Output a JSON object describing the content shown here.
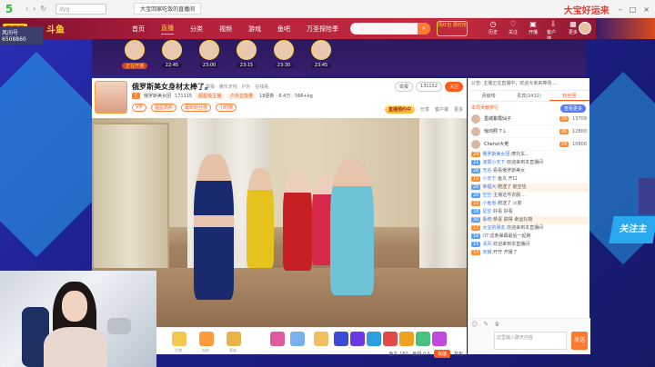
{
  "browser": {
    "logo": "5",
    "address": "dyg",
    "tab_title": "大宝回家吃饭的直播间",
    "brand": "大宝好运来"
  },
  "header": {
    "tag": "风间号",
    "uid": "6508860",
    "logo_text": "斗鱼",
    "nav": [
      "首页",
      "直播",
      "分类",
      "视频",
      "游戏",
      "鱼吧",
      "万圣探险季"
    ],
    "search_placeholder": "",
    "pill": "领红包 限时抢",
    "icons": [
      "历史",
      "关注",
      "开播",
      "客户端",
      "更多"
    ]
  },
  "anchors": [
    {
      "time": "正在开播",
      "hot": true
    },
    {
      "time": "22:45",
      "hot": false
    },
    {
      "time": "23:00",
      "hot": false
    },
    {
      "time": "23:15",
      "hot": false
    },
    {
      "time": "23:30",
      "hot": false
    },
    {
      "time": "23:45",
      "hot": false
    }
  ],
  "room": {
    "title": "俄罗斯美女身材太棒了。",
    "small": "举报 · 娱乐天地 · 户外 · 在线看",
    "name": "俄罗斯美女团",
    "room_no": "171115",
    "badge1": "超星级主播",
    "badge2": "户外正能量",
    "chip1": "VIP",
    "chip2": "福星高照",
    "chip3": "最新粉丝榜",
    "chip4": "小时榜",
    "stats": "18更新 · 8.4万 · 566+kg",
    "btn_report": "举报",
    "btn_count": "131152",
    "btn_follow": "关注",
    "coin": "直播预约中",
    "share": "分享",
    "client": "客户端",
    "more": "更多"
  },
  "toolbar": {
    "labels": [
      "礼物",
      "钻粉",
      "贵族",
      "",
      "",
      "",
      "",
      "",
      "",
      "",
      "",
      ""
    ],
    "right": "鱼丸 160 · 鱼翅 0.6",
    "charge": "充值",
    "backpack": "背包"
  },
  "chat": {
    "notice": "公告: 主播正在直播中，欢迎大家来捧场...",
    "tabs": [
      "贡献榜",
      "贵宾(2432)",
      "粉丝团"
    ],
    "rank_head": "本周贡献排行",
    "rank_btn": "查看更多",
    "ranks": [
      {
        "name": "墨城紫霞仙子",
        "lv": "29",
        "score": "13709"
      },
      {
        "name": "惊鸿照 7 L",
        "lv": "26",
        "score": "12800"
      },
      {
        "name": "Chenxi大佬",
        "lv": "24",
        "score": "10800"
      }
    ],
    "lines": [
      {
        "lv": "23",
        "user": "俄罗斯美女团:",
        "text": "摩托车...",
        "hl": false
      },
      {
        "lv": "21",
        "user": "凌霄小天下:",
        "text": "欢迎来到本直播间",
        "hl": false
      },
      {
        "lv": "26",
        "user": "无名:",
        "text": "看看俄罗斯美女",
        "hl": false
      },
      {
        "lv": "19",
        "user": "小天下:",
        "text": "鱼丸 开口",
        "hl": false
      },
      {
        "lv": "25",
        "user": "幸福大:",
        "text": "赠送了 航空信",
        "hl": true
      },
      {
        "lv": "20",
        "user": "空空:",
        "text": "主播这件衣服...",
        "hl": false
      },
      {
        "lv": "22",
        "user": "小鱼崽:",
        "text": "赠送了 火箭",
        "hl": false
      },
      {
        "lv": "18",
        "user": "星空:",
        "text": "好看 好看",
        "hl": false
      },
      {
        "lv": "30",
        "user": "系统:",
        "text": "恭喜 获得 幸运礼物",
        "hl": true
      },
      {
        "lv": "17",
        "user": "大宝的朋友:",
        "text": "欢迎来到本直播间",
        "hl": false
      },
      {
        "lv": "16",
        "user": "OT:",
        "text": "这条弹幕最后一起跑",
        "hl": false
      },
      {
        "lv": "15",
        "user": "清风:",
        "text": "欢迎来到本直播间",
        "hl": false
      },
      {
        "lv": "14",
        "user": "天朝:",
        "text": "开开 开播了",
        "hl": false
      }
    ],
    "input_placeholder": "这里输入聊天内容",
    "send": "发送"
  },
  "overlay": {
    "follow": "关注主"
  }
}
